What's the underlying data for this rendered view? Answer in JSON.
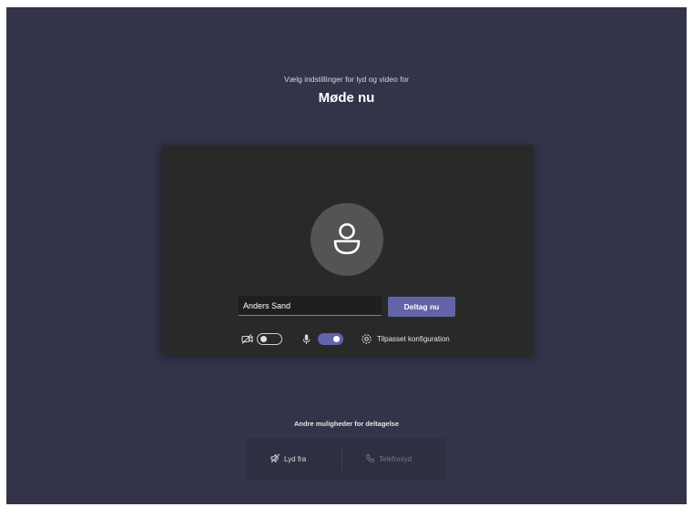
{
  "header": {
    "subtitle": "Vælg indstillinger for lyd og video for",
    "title": "Møde nu"
  },
  "prejoin": {
    "avatar_icon": "person-icon",
    "name_value": "Anders Sand",
    "join_label": "Deltag nu",
    "video_toggle": {
      "icon": "camera-off-icon",
      "state": "off"
    },
    "mic_toggle": {
      "icon": "microphone-icon",
      "state": "on"
    },
    "config": {
      "icon": "gear-icon",
      "label": "Tilpasset konfiguration"
    }
  },
  "other_options": {
    "heading": "Andre muligheder for deltagelse",
    "audio_off_label": "Lyd fra",
    "phone_label": "Telefonlyd"
  },
  "colors": {
    "background": "#33344a",
    "card": "#292929",
    "accent": "#6264a7"
  }
}
